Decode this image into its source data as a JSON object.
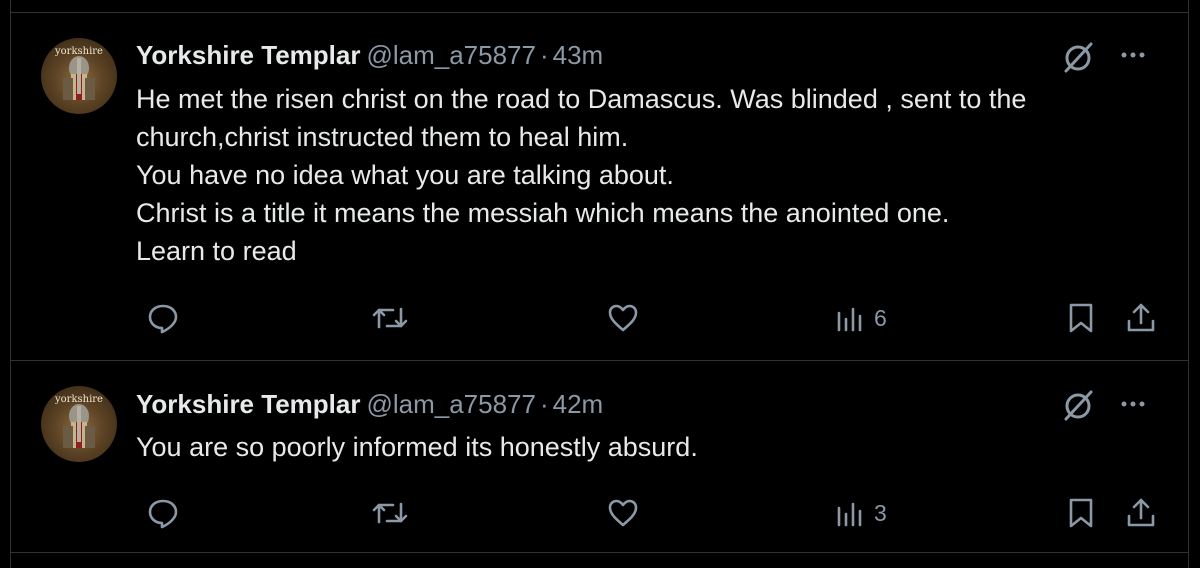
{
  "tweets": [
    {
      "author_name": "Yorkshire Templar",
      "handle": "@lam_a75877",
      "separator": "·",
      "time": "43m",
      "avatar_text": "yorkshire",
      "lines": [
        "He met the risen christ on the road to Damascus. Was blinded , sent to the",
        "church,christ instructed them to heal him.",
        "You have no idea what you are talking about.",
        "Christ is a title it means the messiah which means the anointed one.",
        "Learn to read"
      ],
      "views": "6"
    },
    {
      "author_name": "Yorkshire Templar",
      "handle": "@lam_a75877",
      "separator": "·",
      "time": "42m",
      "avatar_text": "yorkshire",
      "lines": [
        "You are so poorly informed its honestly absurd."
      ],
      "views": "3"
    }
  ],
  "icons": {
    "reply": "reply-icon",
    "repost": "repost-icon",
    "like": "heart-icon",
    "views": "analytics-icon",
    "bookmark": "bookmark-icon",
    "share": "share-icon",
    "grok": "grok-icon",
    "more": "more-icon"
  },
  "colors": {
    "background": "#000000",
    "text": "#e7e9ea",
    "secondary": "#8b98a5",
    "divider": "#2f3336"
  }
}
